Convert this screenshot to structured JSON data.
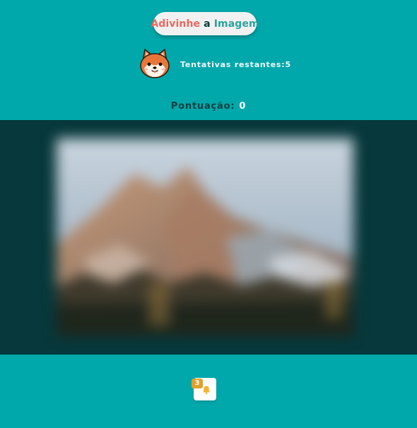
{
  "header": {
    "title_part1": "Adivinhe",
    "title_part2": "a",
    "title_part3": "Imagem"
  },
  "status": {
    "tries_label": "Tentativas restantes:",
    "tries_value": "5",
    "score_label": "Pontuação:",
    "score_value": "0"
  },
  "avatar": {
    "icon": "shiba-dog-icon"
  },
  "image": {
    "content": "blurred-mountain-photo"
  },
  "hint": {
    "icon": "bell-icon",
    "count": "3"
  },
  "colors": {
    "background": "#00a8ab",
    "stage": "#07383b",
    "title_accent_1": "#e8685e",
    "title_accent_2": "#2aa39c",
    "badge": "#e0a12c"
  }
}
